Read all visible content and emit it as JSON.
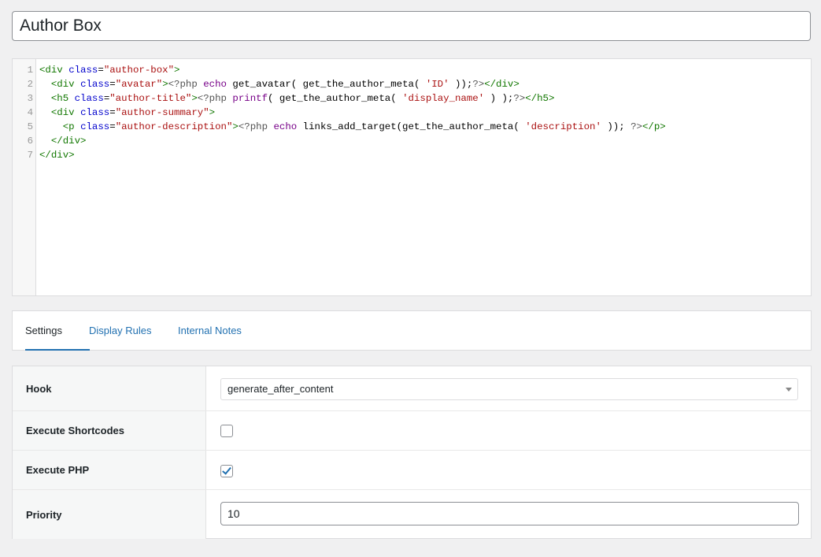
{
  "title": {
    "value": "Author Box"
  },
  "code_editor": {
    "lines": [
      {
        "num": "1",
        "tokens": [
          [
            "t-tag",
            "<div"
          ],
          [
            "t-plain",
            " "
          ],
          [
            "t-attr",
            "class"
          ],
          [
            "t-plain",
            "="
          ],
          [
            "t-str",
            "\"author-box\""
          ],
          [
            "t-tag",
            ">"
          ]
        ]
      },
      {
        "num": "2",
        "tokens": [
          [
            "t-plain",
            "  "
          ],
          [
            "t-tag",
            "<div"
          ],
          [
            "t-plain",
            " "
          ],
          [
            "t-attr",
            "class"
          ],
          [
            "t-plain",
            "="
          ],
          [
            "t-str",
            "\"avatar\""
          ],
          [
            "t-tag",
            ">"
          ],
          [
            "t-meta",
            "<?php"
          ],
          [
            "t-plain",
            " "
          ],
          [
            "t-kw",
            "echo"
          ],
          [
            "t-plain",
            " get_avatar( get_the_author_meta( "
          ],
          [
            "t-str",
            "'ID'"
          ],
          [
            "t-plain",
            " ));"
          ],
          [
            "t-meta",
            "?>"
          ],
          [
            "t-tag",
            "</div>"
          ]
        ]
      },
      {
        "num": "3",
        "tokens": [
          [
            "t-plain",
            "  "
          ],
          [
            "t-tag",
            "<h5"
          ],
          [
            "t-plain",
            " "
          ],
          [
            "t-attr",
            "class"
          ],
          [
            "t-plain",
            "="
          ],
          [
            "t-str",
            "\"author-title\""
          ],
          [
            "t-tag",
            ">"
          ],
          [
            "t-meta",
            "<?php"
          ],
          [
            "t-plain",
            " "
          ],
          [
            "t-kw",
            "printf"
          ],
          [
            "t-plain",
            "( get_the_author_meta( "
          ],
          [
            "t-str",
            "'display_name'"
          ],
          [
            "t-plain",
            " ) );"
          ],
          [
            "t-meta",
            "?>"
          ],
          [
            "t-tag",
            "</h5>"
          ]
        ]
      },
      {
        "num": "4",
        "tokens": [
          [
            "t-plain",
            "  "
          ],
          [
            "t-tag",
            "<div"
          ],
          [
            "t-plain",
            " "
          ],
          [
            "t-attr",
            "class"
          ],
          [
            "t-plain",
            "="
          ],
          [
            "t-str",
            "\"author-summary\""
          ],
          [
            "t-tag",
            ">"
          ]
        ]
      },
      {
        "num": "5",
        "tokens": [
          [
            "t-plain",
            "    "
          ],
          [
            "t-tag",
            "<p"
          ],
          [
            "t-plain",
            " "
          ],
          [
            "t-attr",
            "class"
          ],
          [
            "t-plain",
            "="
          ],
          [
            "t-str",
            "\"author-description\""
          ],
          [
            "t-tag",
            ">"
          ],
          [
            "t-meta",
            "<?php"
          ],
          [
            "t-plain",
            " "
          ],
          [
            "t-kw",
            "echo"
          ],
          [
            "t-plain",
            " links_add_target(get_the_author_meta( "
          ],
          [
            "t-str",
            "'description'"
          ],
          [
            "t-plain",
            " )); "
          ],
          [
            "t-meta",
            "?>"
          ],
          [
            "t-tag",
            "</p>"
          ]
        ]
      },
      {
        "num": "6",
        "tokens": [
          [
            "t-plain",
            "  "
          ],
          [
            "t-tag",
            "</div>"
          ]
        ]
      },
      {
        "num": "7",
        "tokens": [
          [
            "t-tag",
            "</div>"
          ]
        ]
      }
    ]
  },
  "tabs": [
    {
      "label": "Settings",
      "active": true
    },
    {
      "label": "Display Rules",
      "active": false
    },
    {
      "label": "Internal Notes",
      "active": false
    }
  ],
  "settings": {
    "hook": {
      "label": "Hook",
      "value": "generate_after_content"
    },
    "execute_shortcodes": {
      "label": "Execute Shortcodes",
      "checked": false
    },
    "execute_php": {
      "label": "Execute PHP",
      "checked": true
    },
    "priority": {
      "label": "Priority",
      "value": "10"
    }
  },
  "colors": {
    "accent": "#2271b1",
    "background": "#f0f0f1"
  },
  "icons": {
    "select_caret": "caret-down-icon",
    "checkmark": "checkmark-icon"
  }
}
